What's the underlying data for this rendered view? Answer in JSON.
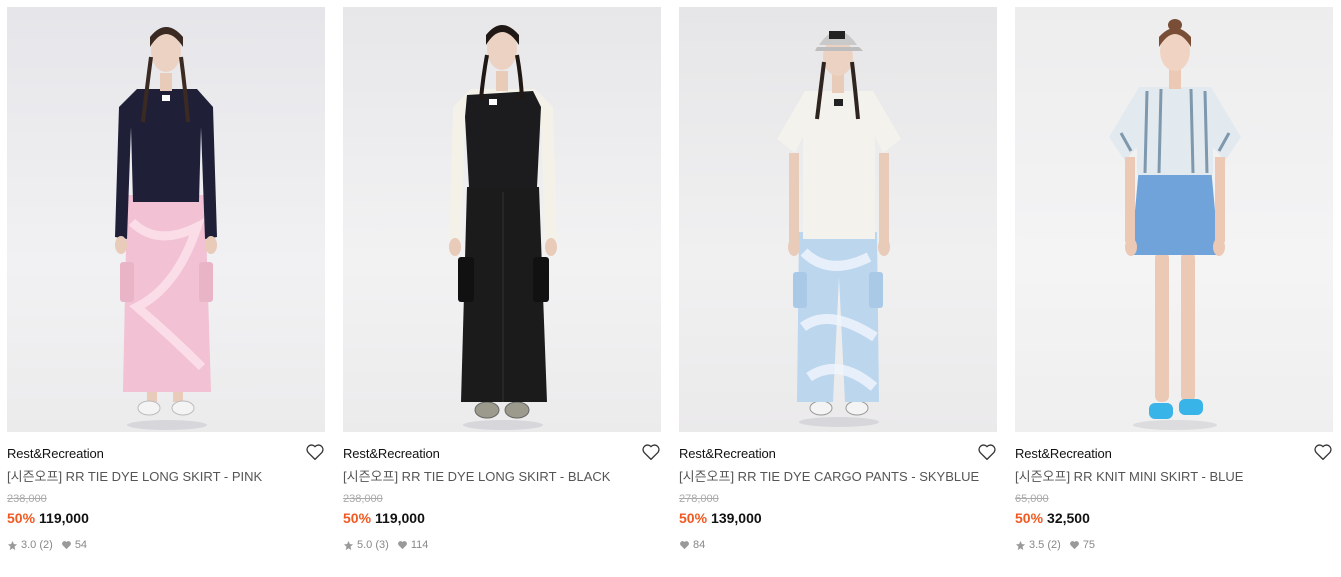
{
  "products": [
    {
      "brand": "Rest&Recreation",
      "title": "[시즌오프] RR TIE DYE LONG SKIRT - PINK",
      "original_price": "238,000",
      "discount": "50%",
      "price": "119,000",
      "rating": "3.0",
      "reviews": "(2)",
      "likes": "54",
      "show_rating": true,
      "top_color": "#1f2038",
      "bottom_color": "#f1bfd0",
      "bottom_type": "long-skirt"
    },
    {
      "brand": "Rest&Recreation",
      "title": "[시즌오프] RR TIE DYE LONG SKIRT - BLACK",
      "original_price": "238,000",
      "discount": "50%",
      "price": "119,000",
      "rating": "5.0",
      "reviews": "(3)",
      "likes": "114",
      "show_rating": true,
      "top_color": "#f4f1e8",
      "bottom_color": "#1b1b1b",
      "bottom_type": "long-skirt"
    },
    {
      "brand": "Rest&Recreation",
      "title": "[시즌오프] RR TIE DYE CARGO PANTS - SKYBLUE",
      "original_price": "278,000",
      "discount": "50%",
      "price": "139,000",
      "rating": "",
      "reviews": "",
      "likes": "84",
      "show_rating": false,
      "top_color": "#f4f2ec",
      "bottom_color": "#b7d3ec",
      "bottom_type": "pants"
    },
    {
      "brand": "Rest&Recreation",
      "title": "[시즌오프] RR KNIT MINI SKIRT - BLUE",
      "original_price": "65,000",
      "discount": "50%",
      "price": "32,500",
      "rating": "3.5",
      "reviews": "(2)",
      "likes": "75",
      "show_rating": true,
      "top_color": "#c9d6df",
      "bottom_color": "#6fa3d9",
      "bottom_type": "mini-skirt"
    }
  ],
  "colors": {
    "discount": "#f05a22",
    "original_price": "#aaaaaa",
    "photo_background": "#efeff1"
  },
  "icons": {
    "wishlist": "heart-outline-icon",
    "rating": "star-icon",
    "likes": "heart-filled-icon"
  }
}
